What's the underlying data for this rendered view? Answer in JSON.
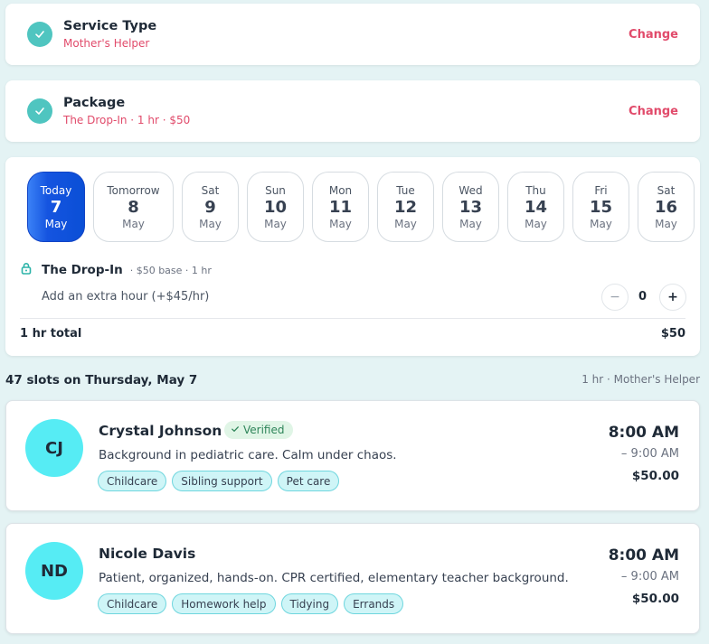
{
  "steps": [
    {
      "title": "Service Type",
      "value": "Mother's Helper",
      "action": "Change"
    },
    {
      "title": "Package",
      "value": "The Drop-In · 1 hr · $50",
      "action": "Change"
    }
  ],
  "dates": [
    {
      "dow": "Today",
      "day": "7",
      "month": "May",
      "selected": true
    },
    {
      "dow": "Tomorrow",
      "day": "8",
      "month": "May",
      "selected": false
    },
    {
      "dow": "Sat",
      "day": "9",
      "month": "May",
      "selected": false
    },
    {
      "dow": "Sun",
      "day": "10",
      "month": "May",
      "selected": false
    },
    {
      "dow": "Mon",
      "day": "11",
      "month": "May",
      "selected": false
    },
    {
      "dow": "Tue",
      "day": "12",
      "month": "May",
      "selected": false
    },
    {
      "dow": "Wed",
      "day": "13",
      "month": "May",
      "selected": false
    },
    {
      "dow": "Thu",
      "day": "14",
      "month": "May",
      "selected": false
    },
    {
      "dow": "Fri",
      "day": "15",
      "month": "May",
      "selected": false
    },
    {
      "dow": "Sat",
      "day": "16",
      "month": "May",
      "selected": false
    }
  ],
  "package": {
    "name": "The Drop-In",
    "meta": "· $50 base · 1 hr",
    "extra_label": "Add an extra hour (+$45/hr)",
    "extra_count": "0",
    "minus": "−",
    "plus": "+",
    "total_label": "1 hr total",
    "total_price": "$50"
  },
  "slots": {
    "title": "47 slots on Thursday, May 7",
    "meta": "1 hr · Mother's Helper"
  },
  "providers": [
    {
      "initials": "CJ",
      "name": "Crystal Johnson",
      "verified": "Verified",
      "bio": "Background in pediatric care. Calm under chaos.",
      "tags": [
        "Childcare",
        "Sibling support",
        "Pet care"
      ],
      "start": "8:00 AM",
      "end": "– 9:00 AM",
      "price": "$50.00"
    },
    {
      "initials": "ND",
      "name": "Nicole Davis",
      "verified": "",
      "bio": "Patient, organized, hands-on. CPR certified, elementary teacher background.",
      "tags": [
        "Childcare",
        "Homework help",
        "Tidying",
        "Errands"
      ],
      "start": "8:00 AM",
      "end": "– 9:00 AM",
      "price": "$50.00"
    }
  ],
  "colors": {
    "accent": "#e14b6b",
    "check": "#4fc5c0",
    "selected_date": "#0a4fd6",
    "avatar": "#56ecf4",
    "tag_bg": "#cff5f7",
    "verified_bg": "#e0f5e6"
  },
  "icons": {
    "step_check": "check-circle-icon",
    "package_lock": "lock-icon",
    "verified_check": "check-icon"
  }
}
